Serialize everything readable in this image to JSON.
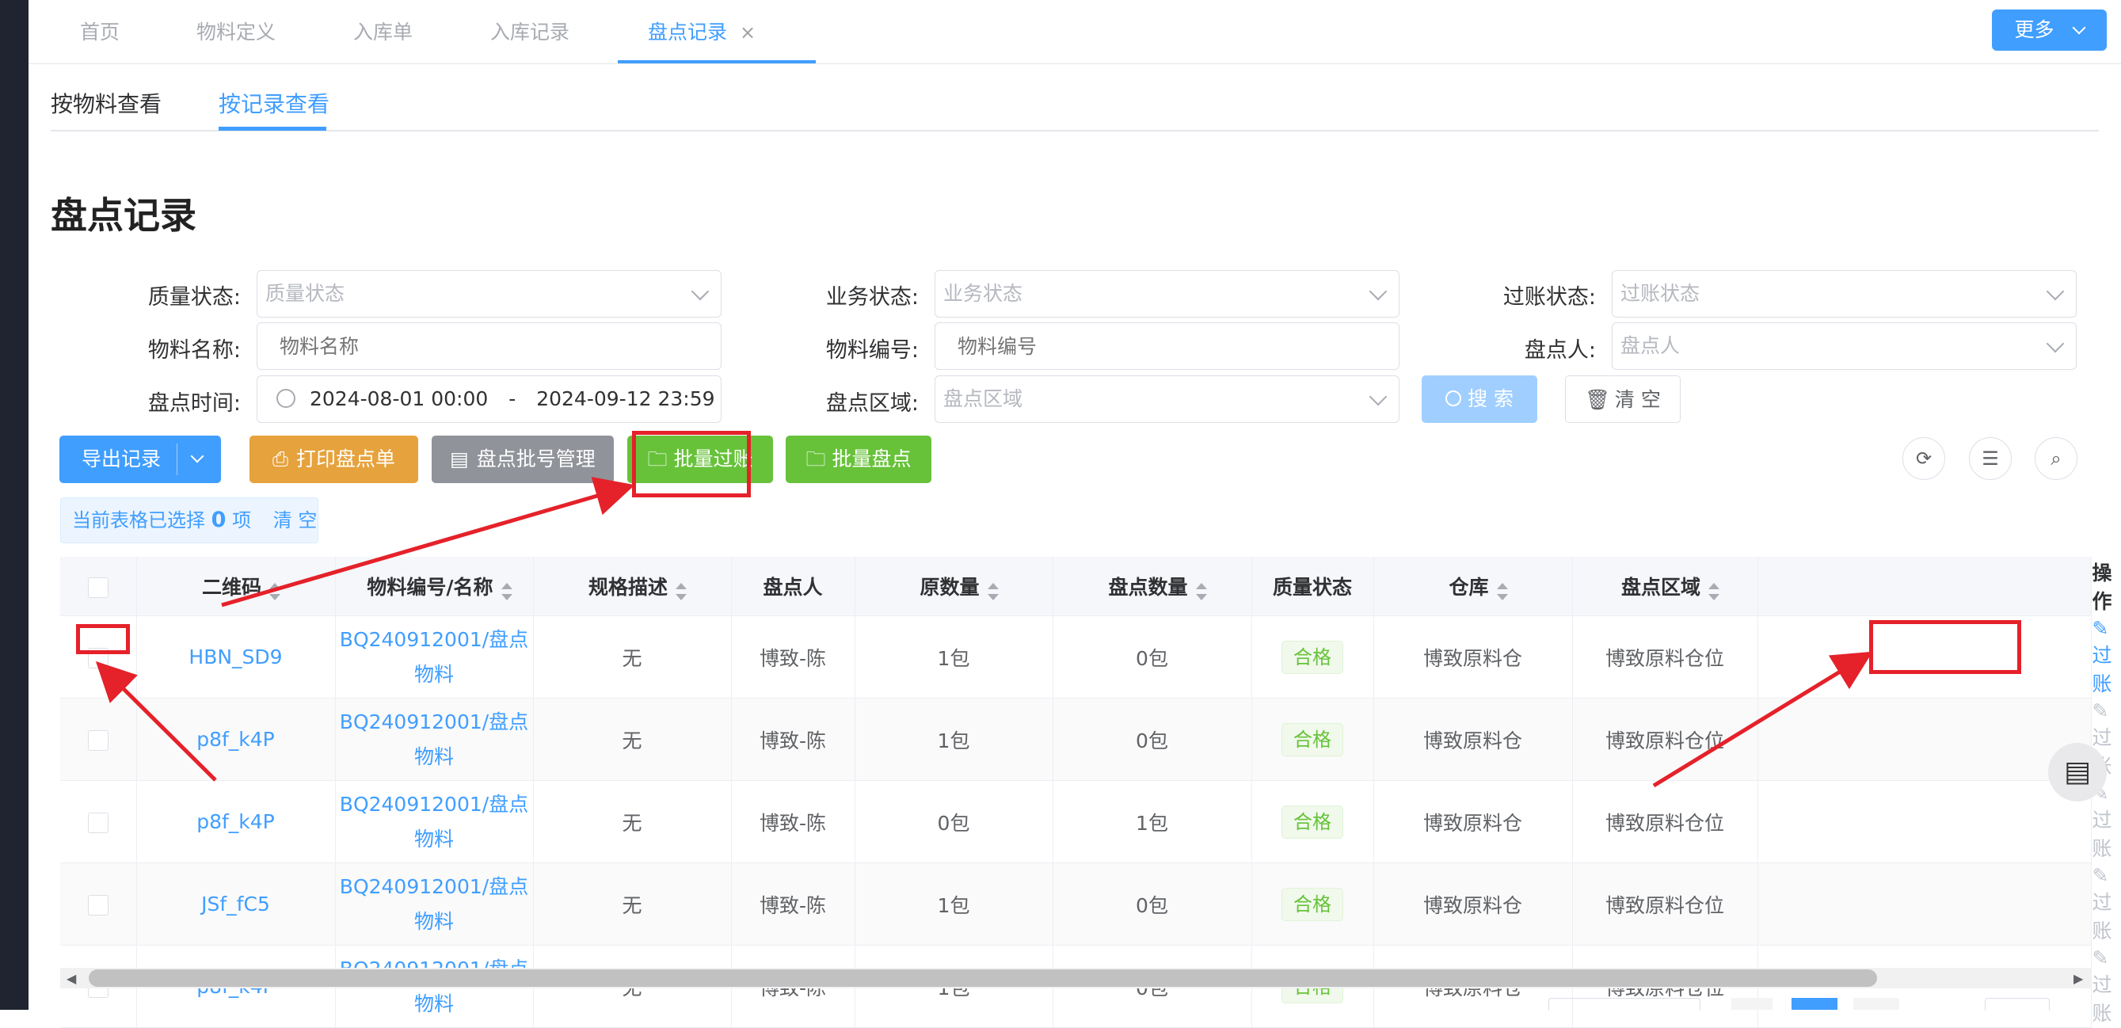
{
  "top_tabs": [
    {
      "label": "首页"
    },
    {
      "label": "物料定义"
    },
    {
      "label": "入库单"
    },
    {
      "label": "入库记录"
    },
    {
      "label": "盘点记录",
      "active": true,
      "close": "×"
    }
  ],
  "more_button": {
    "label": "更多"
  },
  "sub_tabs": [
    {
      "label": "按物料查看"
    },
    {
      "label": "按记录查看",
      "active": true
    }
  ],
  "page_title": "盘点记录",
  "filters": {
    "quality_status": {
      "label": "质量状态:",
      "placeholder": "质量状态"
    },
    "business_status": {
      "label": "业务状态:",
      "placeholder": "业务状态"
    },
    "posting_status": {
      "label": "过账状态:",
      "placeholder": "过账状态"
    },
    "material_name": {
      "label": "物料名称:",
      "placeholder": "物料名称"
    },
    "material_code": {
      "label": "物料编号:",
      "placeholder": "物料编号"
    },
    "checker": {
      "label": "盘点人:",
      "placeholder": "盘点人"
    },
    "check_time": {
      "label": "盘点时间:",
      "start": "2024-08-01 00:00",
      "sep": "-",
      "end": "2024-09-12 23:59"
    },
    "check_area": {
      "label": "盘点区域:",
      "placeholder": "盘点区域"
    }
  },
  "buttons": {
    "search": "搜 索",
    "clear": "清 空",
    "export": "导出记录",
    "print": "打印盘点单",
    "batch_no": "盘点批号管理",
    "batch_post": "批量过账",
    "batch_check": "批量盘点"
  },
  "selection": {
    "prefix": "当前表格已选择",
    "count": "0",
    "suffix": "项",
    "clear": "清 空"
  },
  "table": {
    "columns": [
      "二维码",
      "物料编号/名称",
      "规格描述",
      "盘点人",
      "原数量",
      "盘点数量",
      "质量状态",
      "仓库",
      "盘点区域",
      "操作"
    ],
    "rows": [
      {
        "qr": "HBN_SD9",
        "mat1": "BQ240912001/盘点",
        "mat2": "物料",
        "spec": "无",
        "checker": "博致-陈",
        "orig": "1包",
        "counted": "0包",
        "quality": "合格",
        "warehouse": "博致原料仓",
        "area": "博致原料仓位",
        "op": "过账",
        "enabled": true
      },
      {
        "qr": "p8f_k4P",
        "mat1": "BQ240912001/盘点",
        "mat2": "物料",
        "spec": "无",
        "checker": "博致-陈",
        "orig": "1包",
        "counted": "0包",
        "quality": "合格",
        "warehouse": "博致原料仓",
        "area": "博致原料仓位",
        "op": "过账",
        "enabled": false
      },
      {
        "qr": "p8f_k4P",
        "mat1": "BQ240912001/盘点",
        "mat2": "物料",
        "spec": "无",
        "checker": "博致-陈",
        "orig": "0包",
        "counted": "1包",
        "quality": "合格",
        "warehouse": "博致原料仓",
        "area": "博致原料仓位",
        "op": "过账",
        "enabled": false
      },
      {
        "qr": "JSf_fC5",
        "mat1": "BQ240912001/盘点",
        "mat2": "物料",
        "spec": "无",
        "checker": "博致-陈",
        "orig": "1包",
        "counted": "0包",
        "quality": "合格",
        "warehouse": "博致原料仓",
        "area": "博致原料仓位",
        "op": "过账",
        "enabled": false
      },
      {
        "qr": "p8f_k4P",
        "mat1": "BQ240912001/盘点",
        "mat2": "物料",
        "spec": "无",
        "checker": "博致-陈",
        "orig": "1包",
        "counted": "0包",
        "quality": "合格",
        "warehouse": "博致原料仓",
        "area": "博致原料仓位",
        "op": "过账",
        "enabled": false
      }
    ]
  },
  "colors": {
    "primary": "#409eff",
    "warning": "#e6a23c",
    "info": "#909399",
    "success": "#67c23a",
    "annotation": "#e5212a"
  }
}
